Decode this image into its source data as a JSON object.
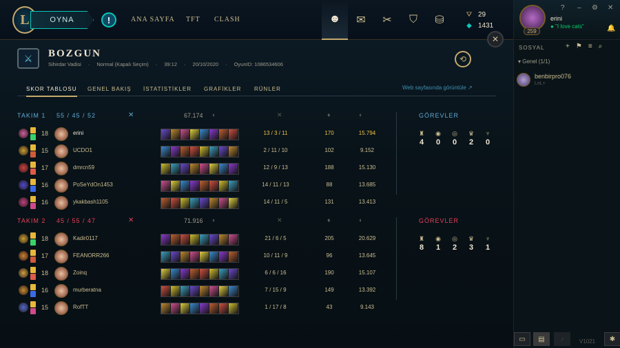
{
  "nav": {
    "play": "OYNA",
    "alert": "!",
    "links": [
      "ANA SAYFA",
      "TFT",
      "CLASH"
    ],
    "logo": "L",
    "rp": "29",
    "be": "1431",
    "icons": [
      {
        "name": "profile-icon",
        "glyph": "☻"
      },
      {
        "name": "collection-icon",
        "glyph": "✉"
      },
      {
        "name": "loot-icon",
        "glyph": "✂"
      },
      {
        "name": "clash-icon",
        "glyph": "⛉"
      },
      {
        "name": "store-icon",
        "glyph": "⛁"
      }
    ]
  },
  "profile": {
    "name": "erini",
    "status": "\"I love cats\"",
    "level": "259"
  },
  "window": {
    "help": "?",
    "minimize": "–",
    "settings": "⚙",
    "close": "✕",
    "bell": "🔔",
    "close_panel": "✕"
  },
  "social": {
    "title": "SOSYAL",
    "group": "▾ Genel (1/1)",
    "friend_name": "benbirpro076",
    "friend_sub": "LoL+",
    "icons": [
      "+",
      "⚑",
      "≡",
      "⌕"
    ],
    "version": "V1021"
  },
  "match": {
    "result": "BOZGUN",
    "map": "Sihirdar Vadisi",
    "mode": "Normal (Kapalı Seçim)",
    "duration": "39:12",
    "date": "20/10/2020",
    "game_id": "OyunID: 1086534606",
    "mode_icon": "⚔",
    "replay_icon": "⟲"
  },
  "tabs": [
    "SKOR TABLOSU",
    "GENEL BAKIŞ",
    "İSTATİSTİKLER",
    "GRAFİKLER",
    "RÜNLER"
  ],
  "web_link": "Web sayfasında görüntüle ↗",
  "colors": {
    "team1": "#5fa8d3",
    "team2": "#e84057",
    "gold": "#c8aa6e",
    "highlight": "#f0c341"
  },
  "teams": [
    {
      "name": "TAKIM 1",
      "kda": "55 / 45 / 52",
      "gold": "67.174",
      "sword": "✕",
      "icons": {
        "gold": "◐",
        "kda": "✕",
        "cs": "♦",
        "gold2": "◐"
      },
      "players": [
        {
          "level": "18",
          "name": "erini",
          "kda": "13 / 3 / 11",
          "cs": "170",
          "gold": "15.794",
          "me": true
        },
        {
          "level": "15",
          "name": "UCDO1",
          "kda": "2 / 11 / 10",
          "cs": "102",
          "gold": "9.152"
        },
        {
          "level": "17",
          "name": "dmrcn59",
          "kda": "12 / 9 / 13",
          "cs": "188",
          "gold": "15.130"
        },
        {
          "level": "16",
          "name": "PoSeYdOn1453",
          "kda": "14 / 11 / 13",
          "cs": "88",
          "gold": "13.685"
        },
        {
          "level": "16",
          "name": "ykakbash1105",
          "kda": "14 / 11 / 5",
          "cs": "131",
          "gold": "13.413"
        }
      ],
      "objectives_title": "GÖREVLER",
      "objectives": [
        {
          "icon": "♜",
          "value": "4"
        },
        {
          "icon": "◉",
          "value": "0"
        },
        {
          "icon": "◎",
          "value": "0"
        },
        {
          "icon": "♛",
          "value": "2"
        },
        {
          "icon": "♆",
          "value": "0"
        }
      ]
    },
    {
      "name": "TAKIM 2",
      "kda": "45 / 55 / 47",
      "gold": "71.916",
      "sword": "✕",
      "icons": {
        "gold": "◐",
        "kda": "✕",
        "cs": "♦",
        "gold2": "◐"
      },
      "players": [
        {
          "level": "18",
          "name": "Kadir0117",
          "kda": "21 / 6 / 5",
          "cs": "205",
          "gold": "20.629"
        },
        {
          "level": "17",
          "name": "FEANORR266",
          "kda": "10 / 11 / 9",
          "cs": "96",
          "gold": "13.645"
        },
        {
          "level": "18",
          "name": "Zoinq",
          "kda": "6 / 6 / 16",
          "cs": "190",
          "gold": "15.107"
        },
        {
          "level": "16",
          "name": "murberatna",
          "kda": "7 / 15 / 9",
          "cs": "149",
          "gold": "13.392"
        },
        {
          "level": "15",
          "name": "RofTT",
          "kda": "1 / 17 / 8",
          "cs": "43",
          "gold": "9.143"
        }
      ],
      "objectives_title": "GÖREVLER",
      "objectives": [
        {
          "icon": "♜",
          "value": "8"
        },
        {
          "icon": "◉",
          "value": "1"
        },
        {
          "icon": "◎",
          "value": "2"
        },
        {
          "icon": "♛",
          "value": "3"
        },
        {
          "icon": "♆",
          "value": "1"
        }
      ]
    }
  ]
}
